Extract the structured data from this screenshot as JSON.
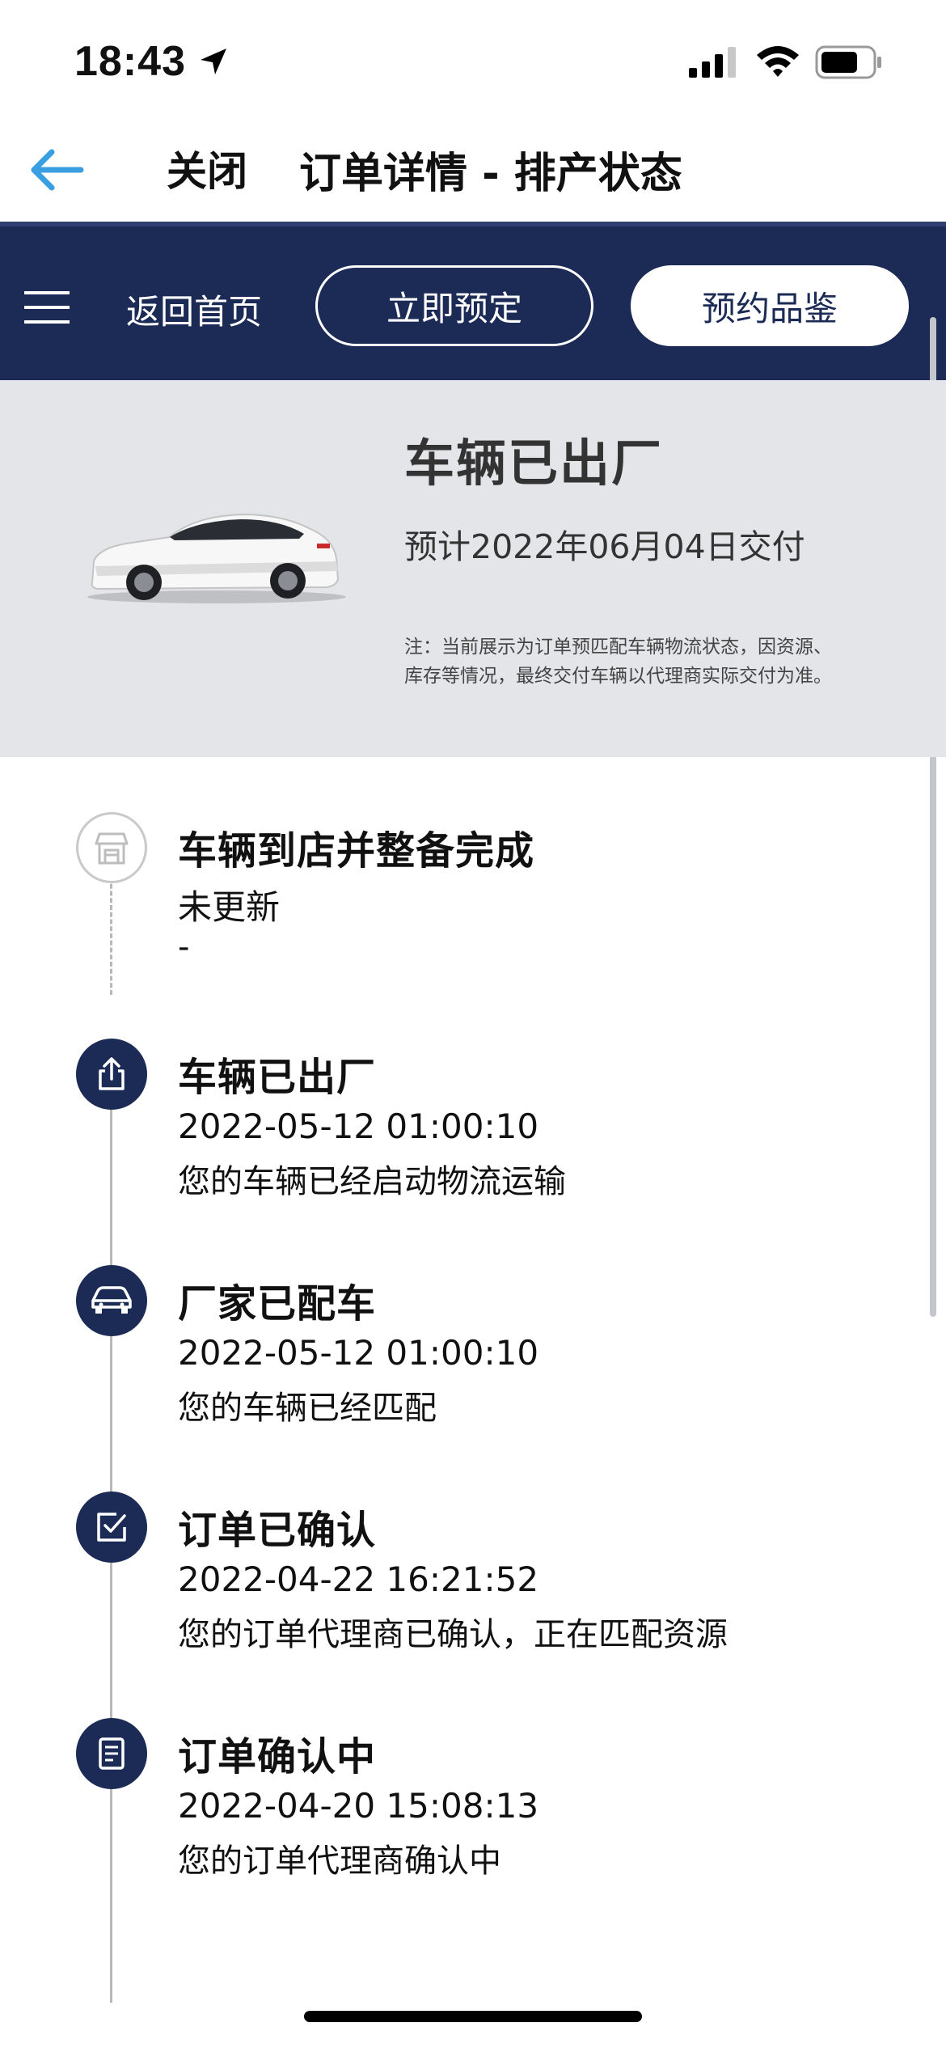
{
  "status_bar": {
    "time": "18:43",
    "icons": [
      "location-arrow-icon",
      "cellular-signal-icon",
      "wifi-icon",
      "battery-icon"
    ]
  },
  "title_bar": {
    "back_icon": "back-arrow-icon",
    "close_label": "关闭",
    "title": "订单详情 - 排产状态"
  },
  "nav": {
    "menu_icon": "hamburger-menu-icon",
    "home_label": "返回首页",
    "order_now_label": "立即预定",
    "test_drive_label": "预约品鉴"
  },
  "hero": {
    "status_title": "车辆已出厂",
    "eta": "预计2022年06月04日交付",
    "note_line1": "注：当前展示为订单预匹配车辆物流状态，因资源、",
    "note_line2": "库存等情况，最终交付车辆以代理商实际交付为准。"
  },
  "timeline": [
    {
      "title": "车辆到店并整备完成",
      "time": "未更新",
      "desc": "-",
      "icon": "store-icon",
      "done": false
    },
    {
      "title": "车辆已出厂",
      "time": "2022-05-12 01:00:10",
      "desc": "您的车辆已经启动物流运输",
      "icon": "share-out-icon",
      "done": true
    },
    {
      "title": "厂家已配车",
      "time": "2022-05-12 01:00:10",
      "desc": "您的车辆已经匹配",
      "icon": "car-icon",
      "done": true
    },
    {
      "title": "订单已确认",
      "time": "2022-04-22 16:21:52",
      "desc": "您的订单代理商已确认，正在匹配资源",
      "icon": "checkbox-icon",
      "done": true
    },
    {
      "title": "订单确认中",
      "time": "2022-04-20 15:08:13",
      "desc": "您的订单代理商确认中",
      "icon": "document-icon",
      "done": true
    }
  ],
  "colors": {
    "nav_bg": "#1b2b55",
    "hero_bg": "#e4e5e8",
    "accent_back": "#3a9fe0",
    "timeline_line": "#b8b8b8"
  }
}
